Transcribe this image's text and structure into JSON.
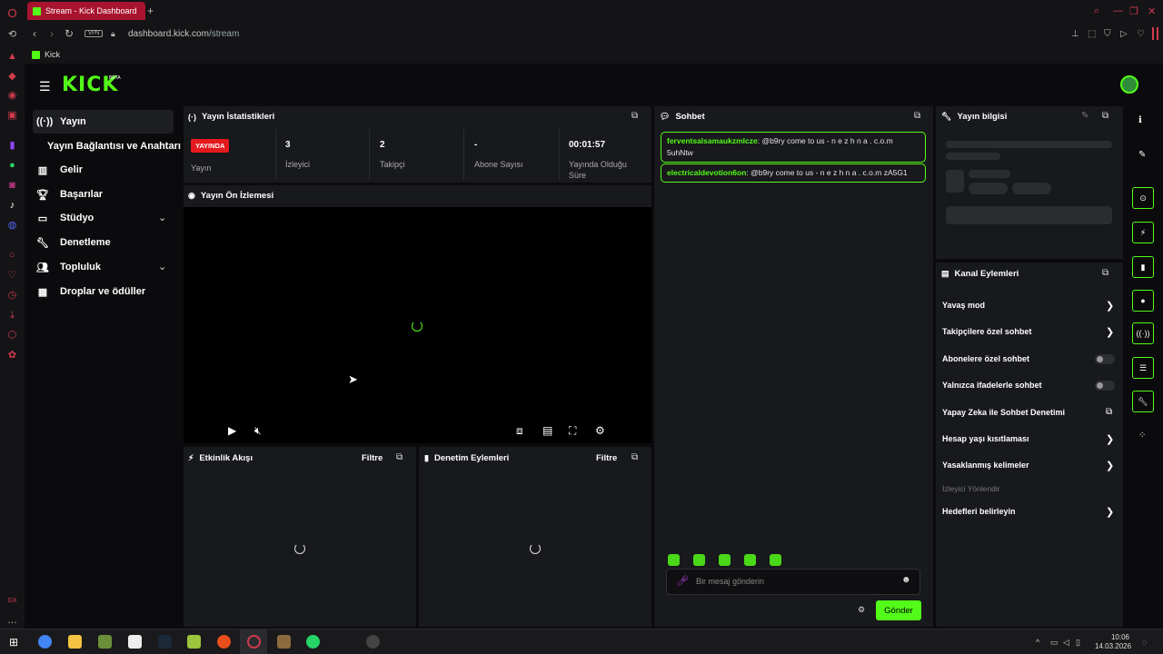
{
  "browser": {
    "tab_title": "Stream - Kick Dashboard",
    "new_tab": "+",
    "vpn_label": "VPN",
    "url_host": "dashboard.kick.com",
    "url_path": "/stream",
    "bookmark_label": "Kick"
  },
  "app": {
    "logo": "KICK",
    "logo_badge": "BETA"
  },
  "nav": {
    "items": [
      {
        "label": "Yayın",
        "icon": "broadcast-icon"
      },
      {
        "label": "Yayın Bağlantısı ve Anahtarı",
        "icon": ""
      },
      {
        "label": "Gelir",
        "icon": "chart-icon"
      },
      {
        "label": "Başarılar",
        "icon": "trophy-icon"
      },
      {
        "label": "Stüdyo",
        "icon": "studio-icon"
      },
      {
        "label": "Denetleme",
        "icon": "wrench-icon"
      },
      {
        "label": "Topluluk",
        "icon": "people-icon"
      },
      {
        "label": "Droplar ve ödüller",
        "icon": "gift-icon"
      }
    ]
  },
  "stats": {
    "title": "Yayın İstatistikleri",
    "live_badge": "YAYINDA",
    "items": [
      {
        "value": "",
        "label": "Yayın"
      },
      {
        "value": "3",
        "label": "İzleyici"
      },
      {
        "value": "2",
        "label": "Takipçi"
      },
      {
        "value": "-",
        "label": "Abone Sayısı"
      },
      {
        "value": "00:01:57",
        "label": "Yayında Olduğu Süre"
      }
    ]
  },
  "preview": {
    "title": "Yayın Ön İzlemesi"
  },
  "activity": {
    "title": "Etkinlik Akışı",
    "filter": "Filtre"
  },
  "moderation": {
    "title": "Denetim Eylemleri",
    "filter": "Filtre"
  },
  "chat": {
    "title": "Sohbet",
    "messages": [
      {
        "user": "ferventsalsamaukzmlcze",
        "text": "@b9ry come to us - n e z h n a . c.o.m 5uhNtw"
      },
      {
        "user": "electricaldevotion6on",
        "text": "@b9ry come to us - n e z h n a . c.o.m zA5G1"
      }
    ],
    "placeholder": "Bir mesaj gönderin",
    "send": "Gönder"
  },
  "info": {
    "title": "Yayın bilgisi"
  },
  "channel_actions": {
    "title": "Kanal Eylemleri",
    "items": [
      {
        "label": "Yavaş mod",
        "control": "chevron"
      },
      {
        "label": "Takipçilere özel sohbet",
        "control": "chevron"
      },
      {
        "label": "Abonelere özel sohbet",
        "control": "toggle"
      },
      {
        "label": "Yalnızca ifadelerle sohbet",
        "control": "toggle"
      },
      {
        "label": "Yapay Zeka ile Sohbet Denetimi",
        "control": "external"
      },
      {
        "label": "Hesap yaşı kısıtlaması",
        "control": "chevron"
      },
      {
        "label": "Yasaklanmış kelimeler",
        "control": "chevron"
      }
    ],
    "section_label": "İzleyici Yönlendir",
    "goal_item": "Hedefleri belirleyin"
  },
  "taskbar": {
    "time": "10:06",
    "date": "14.03.2026"
  },
  "colors": {
    "accent": "#53fc18",
    "live": "#e5191e",
    "opera": "#d23a4d"
  }
}
